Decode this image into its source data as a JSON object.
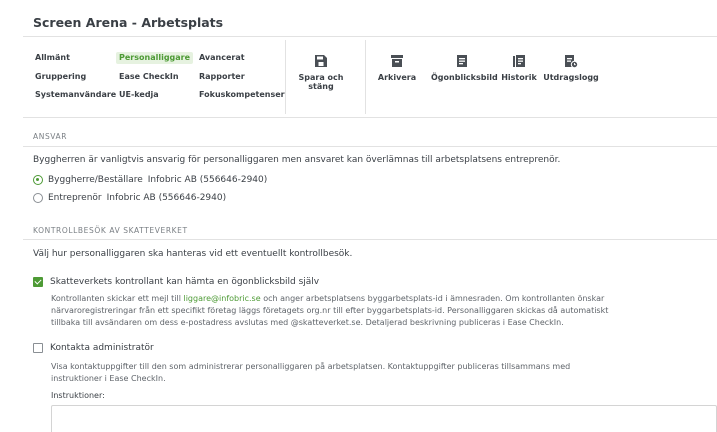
{
  "window": {
    "title": "Screen Arena - Arbetsplats"
  },
  "nav": {
    "allmant": "Allmänt",
    "personalliggare": "Personalliggare",
    "avancerat": "Avancerat",
    "gruppering": "Gruppering",
    "ease_checkin": "Ease CheckIn",
    "rapporter": "Rapporter",
    "systemanvandare": "Systemanvändare",
    "ue_kedja": "UE-kedja",
    "fokuskompetenser": "Fokuskompetenser"
  },
  "toolbar": {
    "spara_line1": "Spara och",
    "spara_line2": "stäng",
    "arkivera": "Arkivera",
    "ogonblicksbild": "Ögonblicksbild",
    "historik": "Historik",
    "utdragslogg": "Utdragslogg"
  },
  "ansvar": {
    "heading": "ANSVAR",
    "description": "Byggherren är vanligtvis ansvarig för personalliggaren men ansvaret kan överlämnas till arbetsplatsens entreprenör.",
    "option1_label": "Byggherre/Beställare",
    "option1_company": "Infobric AB (556646-2940)",
    "option2_label": "Entreprenör",
    "option2_company": "Infobric AB (556646-2940)"
  },
  "kontroll": {
    "heading": "KONTROLLBESÖK AV SKATTEVERKET",
    "description": "Välj hur personalliggaren ska hanteras vid ett eventuellt kontrollbesök.",
    "option1_label": "Skatteverkets kontrollant kan hämta en ögonblicksbild själv",
    "option1_desc_a": "Kontrollanten skickar ett mejl till ",
    "option1_email": "liggare@infobric.se",
    "option1_desc_b": " och anger arbetsplatsens byggarbetsplats-id i ämnesraden. Om kontrollanten önskar",
    "option1_desc_line2": "närvaroregistreringar från ett specifikt företag läggs företagets org.nr till efter byggarbetsplats-id. Personalliggaren skickas då automatiskt",
    "option1_desc_line3": "tillbaka till avsändaren om dess e-postadress avslutas med @skatteverket.se. Detaljerad beskrivning publiceras i Ease CheckIn.",
    "option2_label": "Kontakta administratör",
    "option2_desc_line1": "Visa kontaktuppgifter till den som administrerar personalliggaren på arbetsplatsen. Kontaktuppgifter publiceras tillsammans med",
    "option2_desc_line2": "instruktioner i Ease CheckIn.",
    "instructions_label": "Instruktioner:"
  },
  "colors": {
    "accent": "#4d9a35",
    "active_tab_bg": "#e6f2e0"
  },
  "icons": {
    "save": "save-icon",
    "archive": "archive-icon",
    "snapshot": "document-icon",
    "history": "history-icon",
    "extract_log": "document-clock-icon"
  }
}
